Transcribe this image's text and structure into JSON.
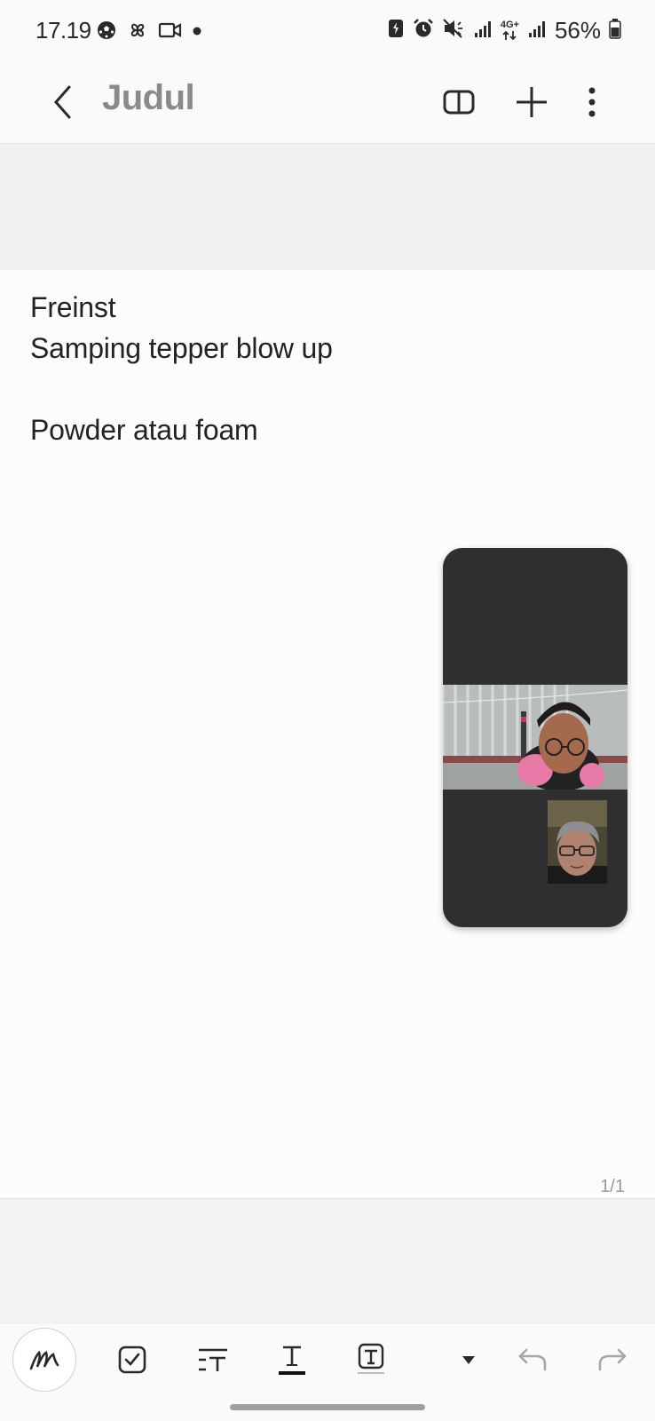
{
  "status_bar": {
    "time": "17.19",
    "battery_percent": "56%",
    "left_icons": [
      "soccer-ball-icon",
      "pinwheel-icon",
      "video-call-icon",
      "dot-icon"
    ],
    "right_icons": [
      "battery-saver-icon",
      "alarm-icon",
      "mute-icon",
      "signal-icon",
      "network-4g-icon",
      "signal-icon",
      "battery-icon"
    ],
    "network_label": "4G+"
  },
  "app_bar": {
    "title": "Judul"
  },
  "note": {
    "lines": [
      "Freinst",
      "Samping tepper blow up",
      "Powder atau foam"
    ]
  },
  "page_indicator": "1/1",
  "toolbar": {
    "tools": [
      "handwriting",
      "checkbox",
      "text-format",
      "text-underline",
      "text-box",
      "more",
      "undo",
      "redo"
    ]
  },
  "colors": {
    "background": "#fcfcfc",
    "title_gray": "#8a8a8a",
    "call_window": "#2f2f2f"
  }
}
